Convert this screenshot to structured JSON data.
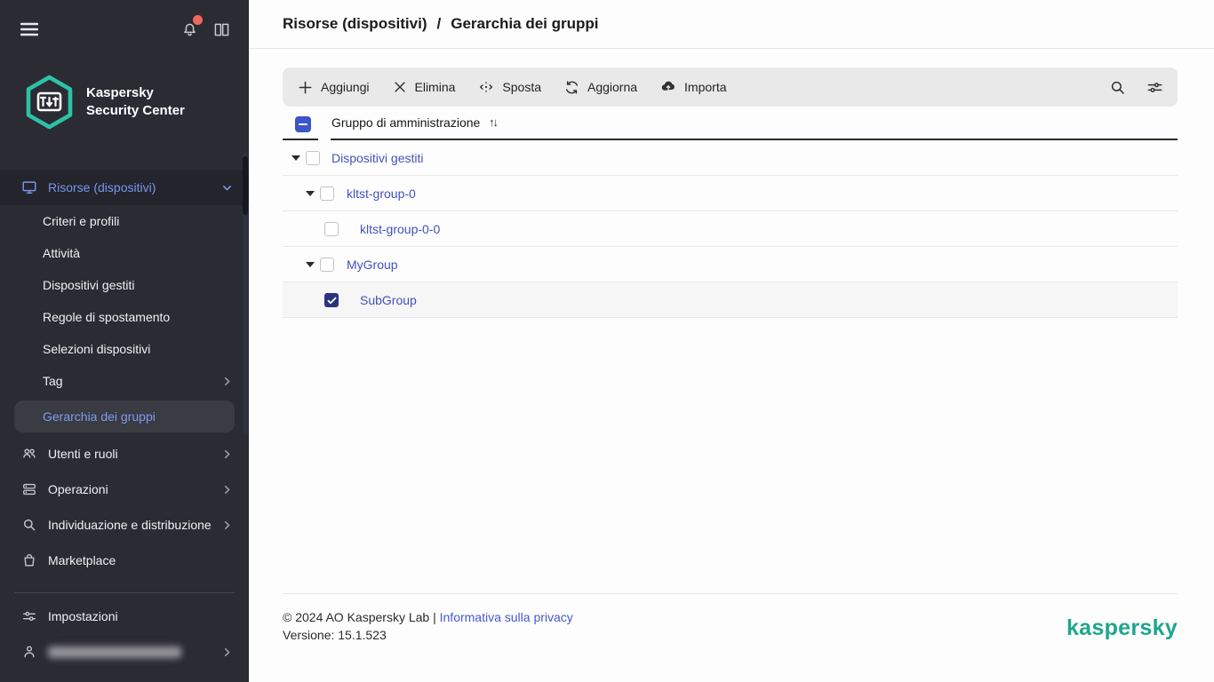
{
  "sidebar": {
    "logo_line1": "Kaspersky",
    "logo_line2": "Security Center",
    "nav": [
      {
        "label": "Risorse (dispositivi)",
        "icon": "monitor-icon",
        "state": "active-parent-expanded"
      },
      {
        "label": "Criteri e profili"
      },
      {
        "label": "Attività"
      },
      {
        "label": "Dispositivi gestiti"
      },
      {
        "label": "Regole di spostamento"
      },
      {
        "label": "Selezioni dispositivi"
      },
      {
        "label": "Tag",
        "has_submenu": true
      },
      {
        "label": "Gerarchia dei gruppi",
        "state": "selected"
      },
      {
        "label": "Utenti e ruoli",
        "icon": "users-icon",
        "has_submenu": true
      },
      {
        "label": "Operazioni",
        "icon": "stack-icon",
        "has_submenu": true
      },
      {
        "label": "Individuazione e distribuzione",
        "icon": "search-icon",
        "has_submenu": true
      },
      {
        "label": "Marketplace",
        "icon": "bag-icon"
      }
    ],
    "settings_label": "Impostazioni",
    "user_account": {
      "name_redacted": true,
      "has_submenu": true
    }
  },
  "header": {
    "breadcrumb": [
      "Risorse (dispositivi)",
      "Gerarchia dei gruppi"
    ],
    "separator": "/"
  },
  "toolbar": {
    "buttons": [
      {
        "label": "Aggiungi",
        "icon": "plus-icon"
      },
      {
        "label": "Elimina",
        "icon": "close-icon"
      },
      {
        "label": "Sposta",
        "icon": "move-icon"
      },
      {
        "label": "Aggiorna",
        "icon": "refresh-icon"
      },
      {
        "label": "Importa",
        "icon": "cloud-upload-icon"
      }
    ],
    "right_icons": [
      "search-icon",
      "filter-icon"
    ]
  },
  "table": {
    "select_all_checkbox": "indeterminate",
    "column_header": "Gruppo di amministrazione",
    "sort_icon": "↑↓",
    "rows": [
      {
        "label": "Dispositivi gestiti",
        "level": 0,
        "expandable": true,
        "expanded": true,
        "checked": false
      },
      {
        "label": "kltst-group-0",
        "level": 1,
        "expandable": true,
        "expanded": true,
        "checked": false
      },
      {
        "label": "kltst-group-0-0",
        "level": 2,
        "expandable": false,
        "checked": false
      },
      {
        "label": "MyGroup",
        "level": 1,
        "expandable": true,
        "expanded": true,
        "checked": false
      },
      {
        "label": "SubGroup",
        "level": 2,
        "expandable": false,
        "checked": true,
        "highlighted": true
      }
    ]
  },
  "footer": {
    "copyright": "© 2024 AO Kaspersky Lab",
    "separator": "|",
    "privacy_link": "Informativa sulla privacy",
    "version": "Versione: 15.1.523",
    "brand": "kaspersky"
  },
  "colors": {
    "sidebar_bg": "#2b2b33",
    "sidebar_selected_bg": "#3a3b43",
    "sidebar_active_blue": "#7896ea",
    "link_blue": "#4152be",
    "checkbox_checked": "#2a3480",
    "checkbox_indeterminate": "#3c55c9",
    "notification_dot": "#f1685f",
    "brand_teal": "#1ea68e",
    "toolbar_bg": "#e9e9ea"
  }
}
